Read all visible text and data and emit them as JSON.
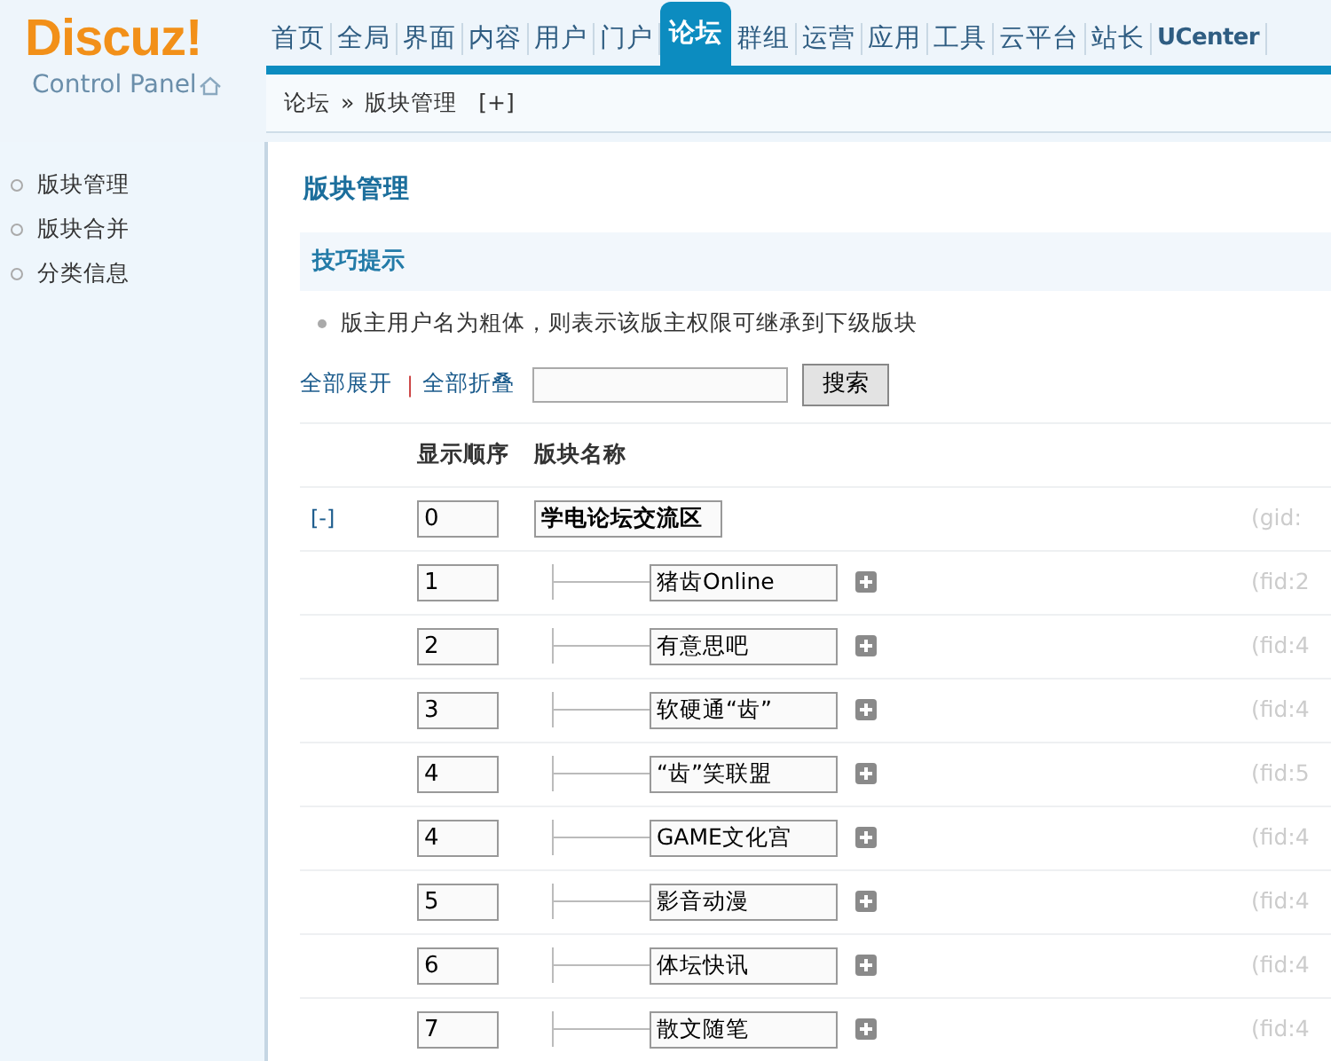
{
  "logo": {
    "brand": "Discuz!",
    "subtitle": "Control Panel"
  },
  "nav_tabs": [
    {
      "label": "首页",
      "selected": false
    },
    {
      "label": "全局",
      "selected": false
    },
    {
      "label": "界面",
      "selected": false
    },
    {
      "label": "内容",
      "selected": false
    },
    {
      "label": "用户",
      "selected": false
    },
    {
      "label": "门户",
      "selected": false
    },
    {
      "label": "论坛",
      "selected": true
    },
    {
      "label": "群组",
      "selected": false
    },
    {
      "label": "运营",
      "selected": false
    },
    {
      "label": "应用",
      "selected": false
    },
    {
      "label": "工具",
      "selected": false
    },
    {
      "label": "云平台",
      "selected": false
    },
    {
      "label": "站长",
      "selected": false
    },
    {
      "label": "UCenter",
      "selected": false
    }
  ],
  "breadcrumb": {
    "items": [
      "论坛",
      "版块管理"
    ],
    "separator": "»",
    "add_link": "[+]"
  },
  "sidebar": {
    "items": [
      {
        "label": "版块管理"
      },
      {
        "label": "版块合并"
      },
      {
        "label": "分类信息"
      }
    ]
  },
  "page_title": "版块管理",
  "tips": {
    "title": "技巧提示",
    "items": [
      "版主用户名为粗体，则表示该版主权限可继承到下级版块"
    ]
  },
  "toolbar": {
    "expand_all": "全部展开",
    "collapse_all": "全部折叠",
    "separator": "|",
    "search_button": "搜索"
  },
  "table": {
    "columns": [
      "显示顺序",
      "版块名称"
    ],
    "rows": [
      {
        "kind": "group",
        "toggle": "[-]",
        "order": "0",
        "name": "学电论坛交流区",
        "id_text": "(gid:"
      },
      {
        "kind": "forum",
        "order": "1",
        "name": "猪齿Online",
        "id_text": "(fid:2"
      },
      {
        "kind": "forum",
        "order": "2",
        "name": "有意思吧",
        "id_text": "(fid:4"
      },
      {
        "kind": "forum",
        "order": "3",
        "name": "软硬通“齿”",
        "id_text": "(fid:4"
      },
      {
        "kind": "forum",
        "order": "4",
        "name": "“齿”笑联盟",
        "id_text": "(fid:5"
      },
      {
        "kind": "forum",
        "order": "4",
        "name": "GAME文化宫",
        "id_text": "(fid:4"
      },
      {
        "kind": "forum",
        "order": "5",
        "name": "影音动漫",
        "id_text": "(fid:4"
      },
      {
        "kind": "forum",
        "order": "6",
        "name": "体坛快讯",
        "id_text": "(fid:4"
      },
      {
        "kind": "forum",
        "order": "7",
        "name": "散文随笔",
        "id_text": "(fid:4"
      }
    ]
  }
}
